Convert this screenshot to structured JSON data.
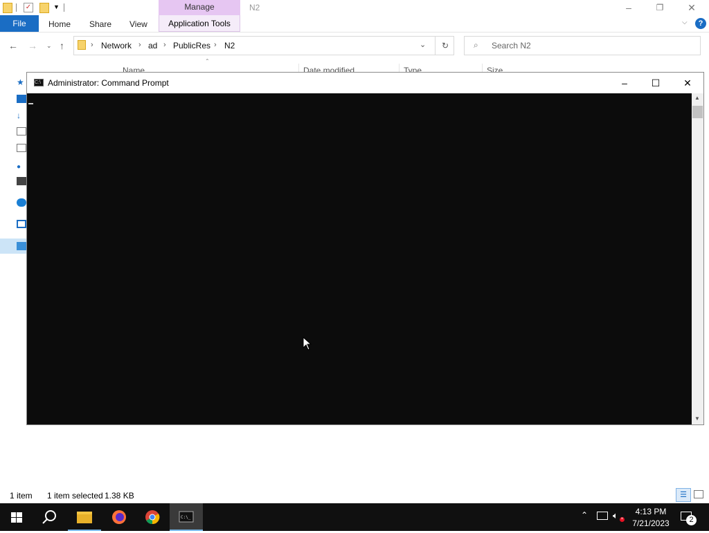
{
  "explorer": {
    "context_tab": "Manage",
    "window_title": "N2",
    "ribbon_tabs": [
      "File",
      "Home",
      "Share",
      "View",
      "Application Tools"
    ],
    "breadcrumb": [
      "Network",
      "ad",
      "PublicRes",
      "N2"
    ],
    "search_placeholder": "Search N2",
    "columns": [
      "Name",
      "Date modified",
      "Type",
      "Size"
    ],
    "status": {
      "items": "1 item",
      "selected": "1 item selected",
      "size": "1.38 KB"
    }
  },
  "cmd": {
    "title": "Administrator:  Command Prompt"
  },
  "taskbar": {
    "apps": [
      "start-icon",
      "search-icon",
      "file-explorer-icon",
      "firefox-icon",
      "chrome-icon",
      "command-prompt-icon"
    ],
    "time": "4:13 PM",
    "date": "7/21/2023",
    "notification_count": "2"
  },
  "colors": {
    "accent": "#1a6dc4",
    "manage_tab": "#e6c6f2",
    "taskbar": "#101010",
    "console": "#0c0c0c"
  }
}
